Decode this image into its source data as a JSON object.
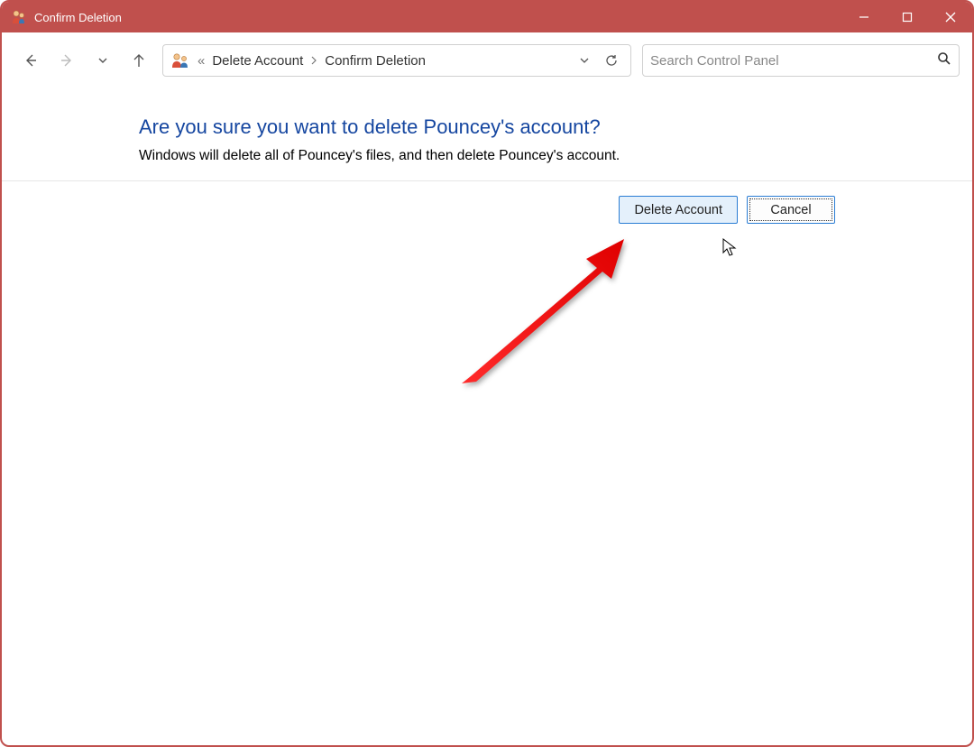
{
  "window": {
    "title": "Confirm Deletion"
  },
  "breadcrumb": {
    "prefix": "«",
    "item1": "Delete Account",
    "item2": "Confirm Deletion"
  },
  "search": {
    "placeholder": "Search Control Panel"
  },
  "main": {
    "heading": "Are you sure you want to delete Pouncey's account?",
    "body": "Windows will delete all of Pouncey's files, and then delete Pouncey's account."
  },
  "buttons": {
    "delete": "Delete Account",
    "cancel": "Cancel"
  }
}
